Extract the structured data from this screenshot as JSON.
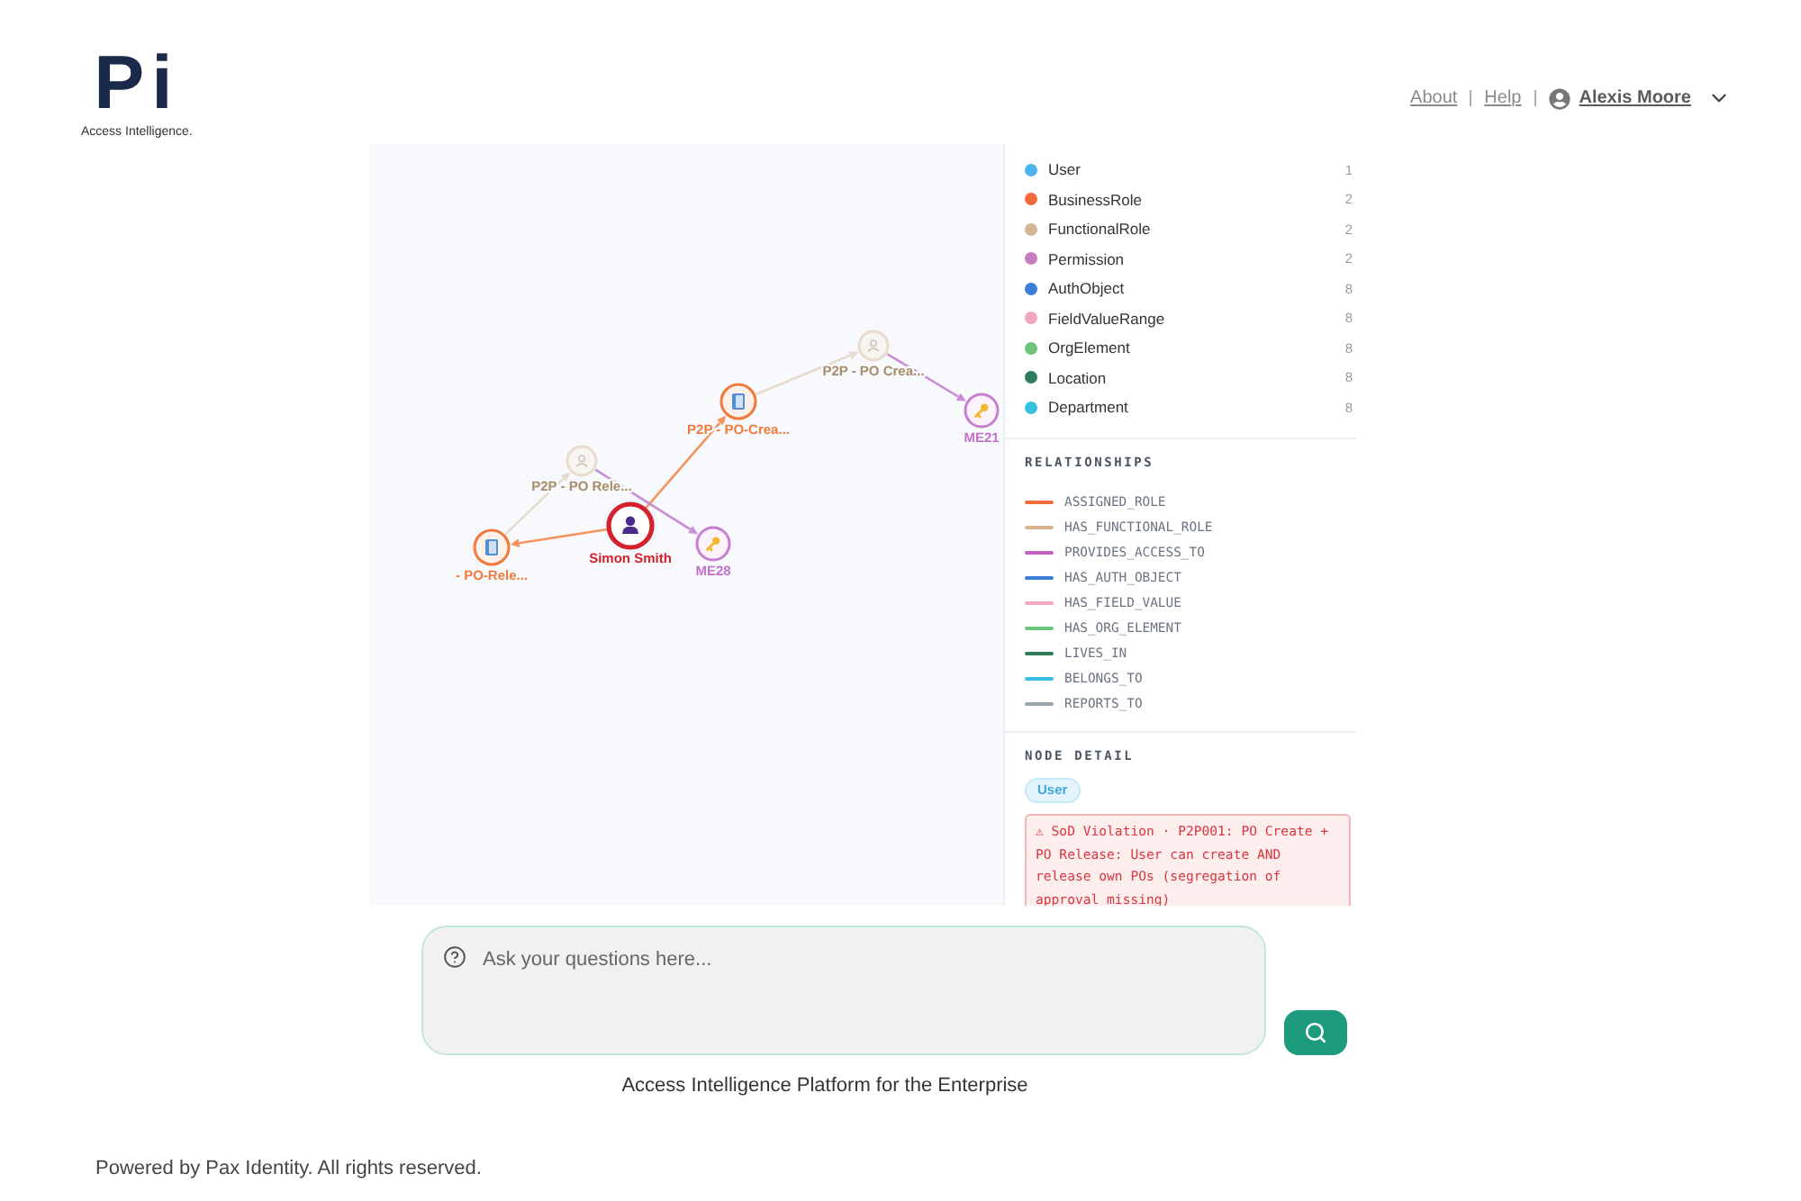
{
  "header": {
    "logo": {
      "text": "Pi",
      "tagline": "Access Intelligence."
    },
    "nav_links": [
      "About",
      "Help"
    ],
    "user": {
      "name": "Alexis Moore"
    }
  },
  "graph": {
    "nodes": [
      {
        "label": "Simon Smith",
        "kind": "user",
        "selected": true,
        "dimmed": false
      },
      {
        "label": "- PO-Rele...",
        "kind": "business_role",
        "selected": false,
        "dimmed": false
      },
      {
        "label": "P2P - PO Rele...",
        "kind": "functional_role",
        "selected": false,
        "dimmed": true
      },
      {
        "label": "ME28",
        "kind": "permission",
        "selected": false,
        "dimmed": false
      },
      {
        "label": "P2P - PO-Crea...",
        "kind": "business_role",
        "selected": false,
        "dimmed": false
      },
      {
        "label": "P2P - PO Crea...",
        "kind": "functional_role",
        "selected": false,
        "dimmed": true
      },
      {
        "label": "ME21",
        "kind": "permission",
        "selected": false,
        "dimmed": false
      }
    ],
    "edges": [
      {
        "kind": "assigned_role",
        "dimmed": false
      },
      {
        "kind": "assigned_role",
        "dimmed": false
      },
      {
        "kind": "has_functional_role",
        "dimmed": true
      },
      {
        "kind": "provides_access_to",
        "dimmed": false
      },
      {
        "kind": "has_functional_role",
        "dimmed": true
      },
      {
        "kind": "provides_access_to",
        "dimmed": false
      }
    ]
  },
  "legend": {
    "node_types": [
      {
        "label": "User",
        "count": "1",
        "color": "#4fb3f0"
      },
      {
        "label": "BusinessRole",
        "count": "2",
        "color": "#f26b3a"
      },
      {
        "label": "FunctionalRole",
        "count": "2",
        "color": "#d4b896"
      },
      {
        "label": "Permission",
        "count": "2",
        "color": "#c77dc4"
      },
      {
        "label": "AuthObject",
        "count": "8",
        "color": "#3b7dd8"
      },
      {
        "label": "FieldValueRange",
        "count": "8",
        "color": "#f0a6c0"
      },
      {
        "label": "OrgElement",
        "count": "8",
        "color": "#6cc47a"
      },
      {
        "label": "Location",
        "count": "8",
        "color": "#2e7d5b"
      },
      {
        "label": "Department",
        "count": "8",
        "color": "#38c0e0"
      }
    ],
    "relationships_title": "RELATIONSHIPS",
    "relationships": [
      {
        "label": "ASSIGNED_ROLE",
        "color": "#f26b3a"
      },
      {
        "label": "HAS_FUNCTIONAL_ROLE",
        "color": "#d9b48f"
      },
      {
        "label": "PROVIDES_ACCESS_TO",
        "color": "#c062c0"
      },
      {
        "label": "HAS_AUTH_OBJECT",
        "color": "#3b7dd8"
      },
      {
        "label": "HAS_FIELD_VALUE",
        "color": "#f4a7c0"
      },
      {
        "label": "HAS_ORG_ELEMENT",
        "color": "#6cc47a"
      },
      {
        "label": "LIVES_IN",
        "color": "#2e7d5b"
      },
      {
        "label": "BELONGS_TO",
        "color": "#38c0e0"
      },
      {
        "label": "REPORTS_TO",
        "color": "#9aa5a8"
      }
    ]
  },
  "node_detail": {
    "title": "NODE DETAIL",
    "badge": "User",
    "alert": "⚠ SoD Violation · P2P001: PO Create + PO Release: User can create AND release own POs (segregation of approval missing)"
  },
  "chat": {
    "placeholder": "Ask your questions here..."
  },
  "tagline": "Access Intelligence Platform for the Enterprise",
  "footer": "Powered by Pax Identity. All rights reserved."
}
